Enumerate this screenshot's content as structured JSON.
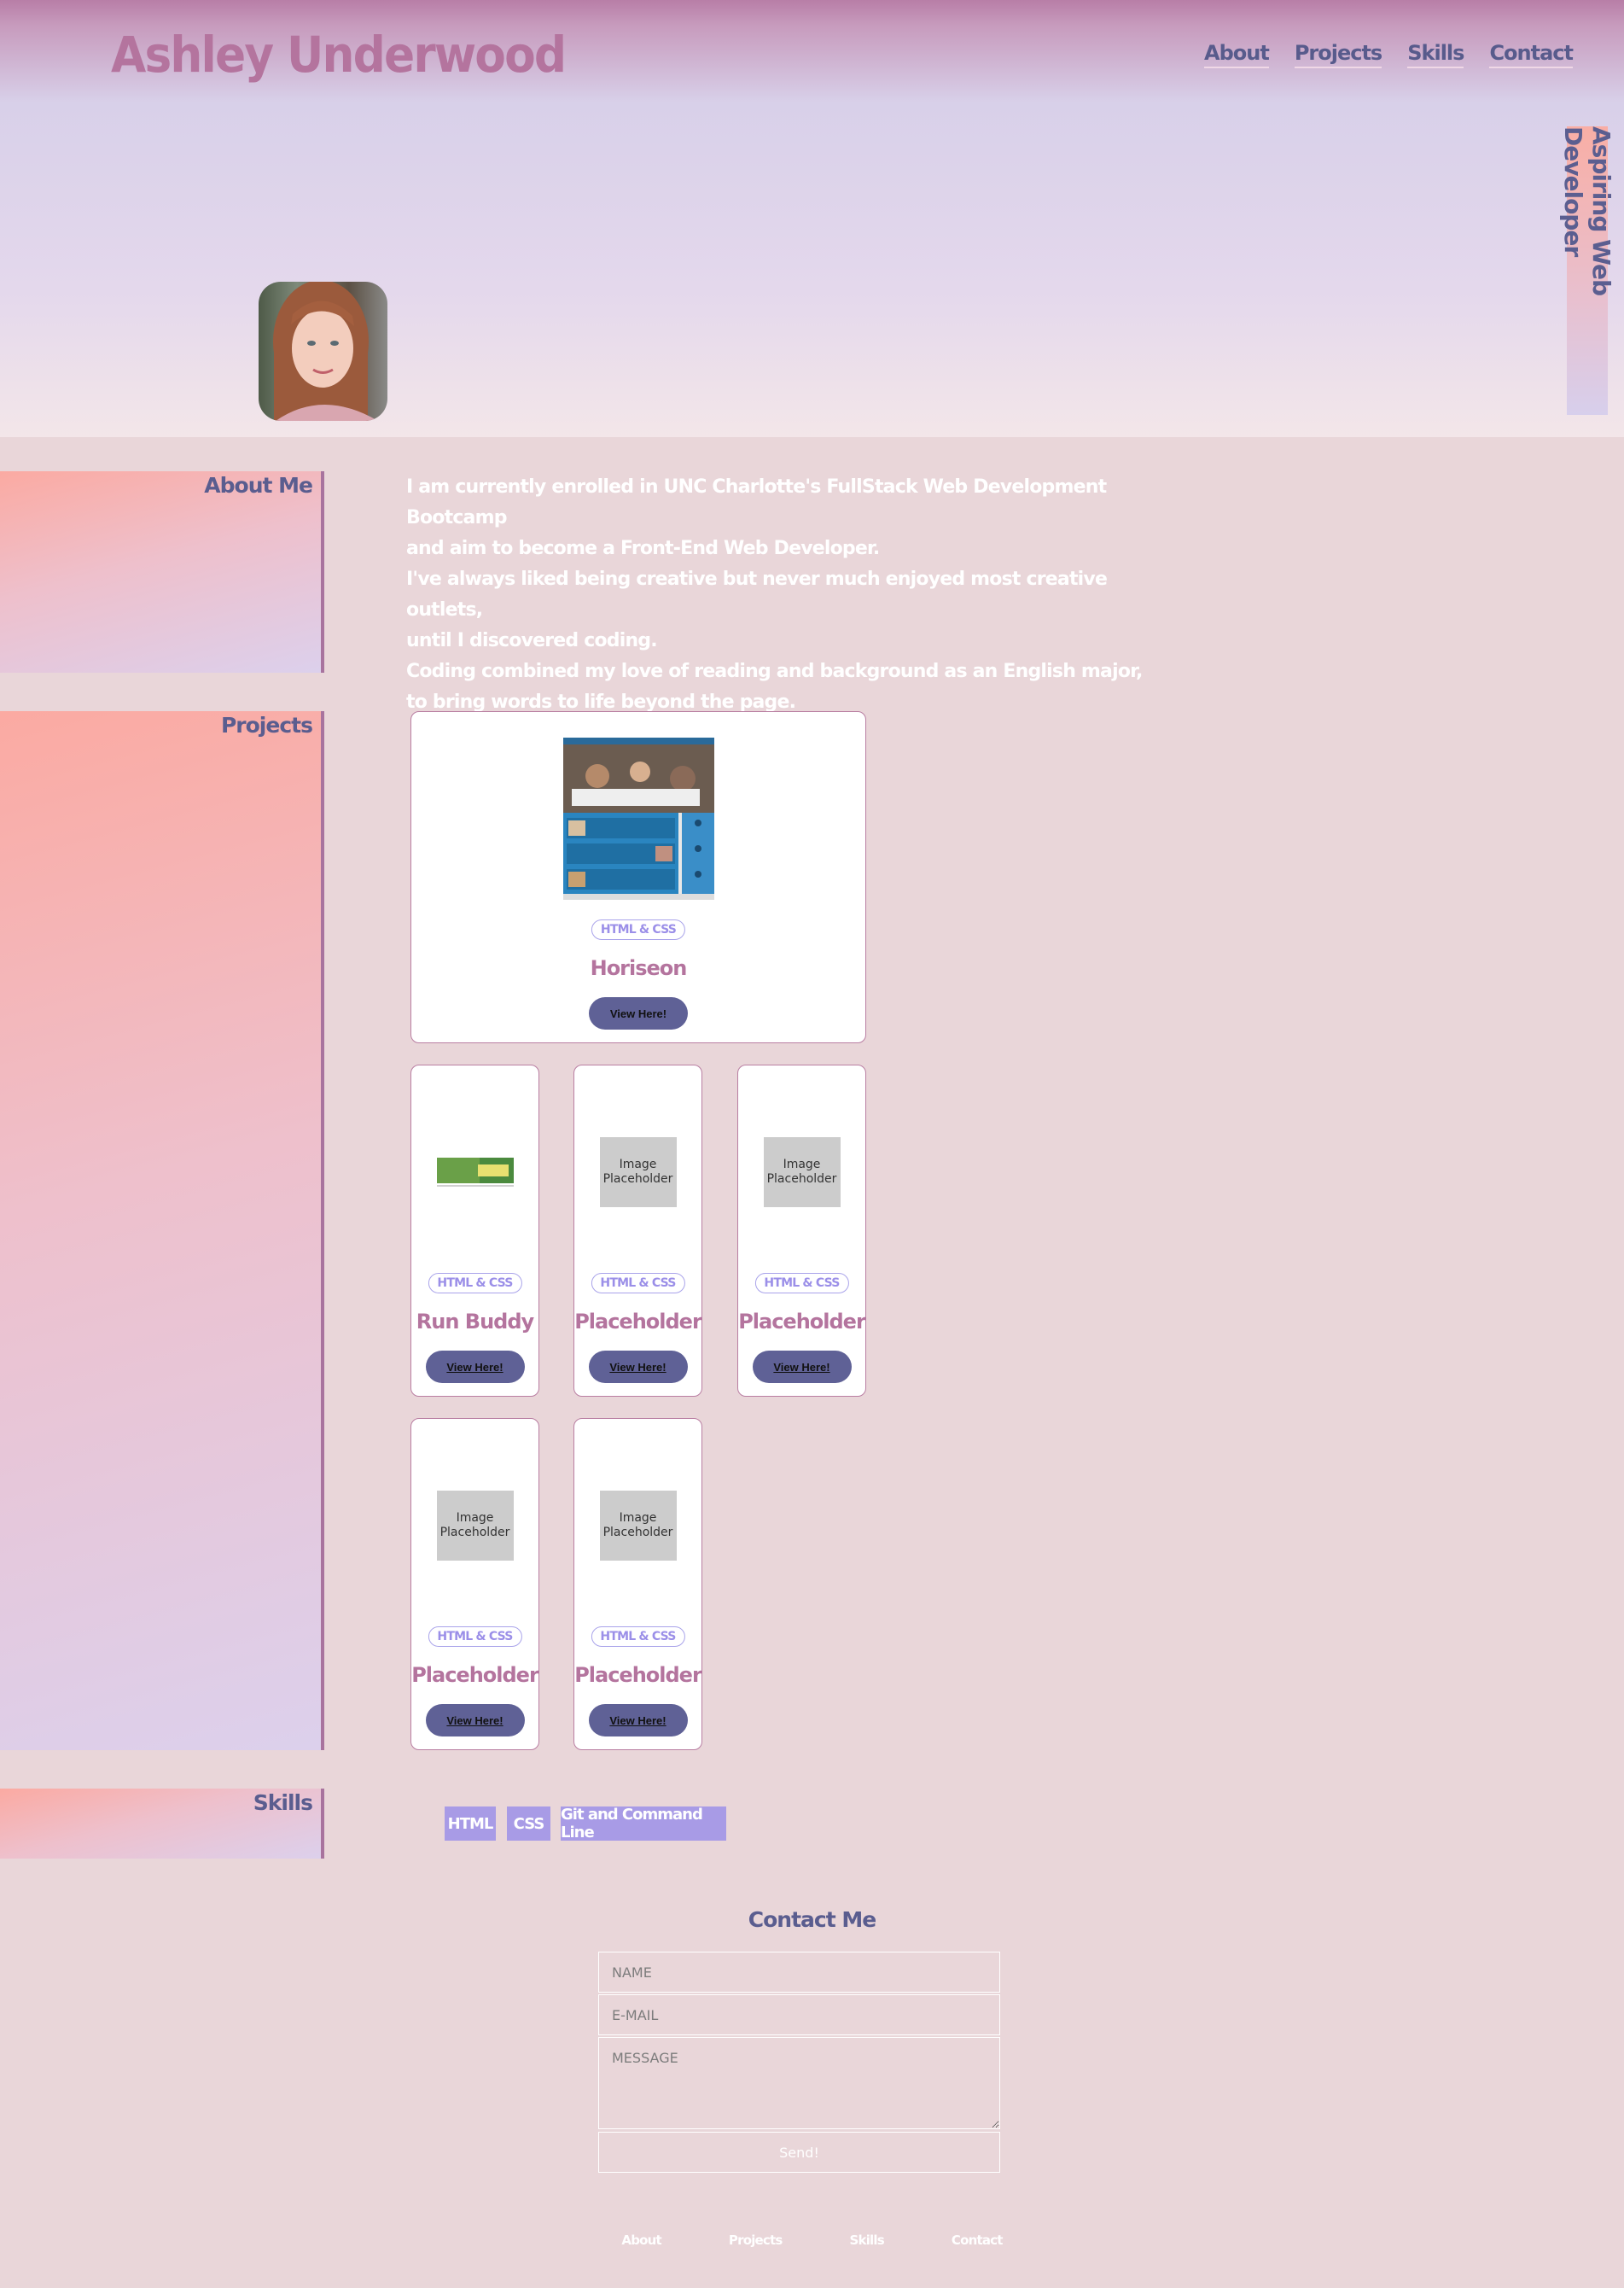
{
  "header": {
    "title": "Ashley Underwood",
    "nav": [
      "About",
      "Projects",
      "Skills",
      "Contact"
    ],
    "tagline": "Aspiring Web Developer"
  },
  "about": {
    "heading": "About Me",
    "lines": [
      "I am currently enrolled in UNC Charlotte's FullStack Web Development Bootcamp",
      "and aim to become a Front-End Web Developer.",
      "I've always liked being creative but never much enjoyed most creative outlets,",
      "until I discovered coding.",
      "Coding combined my love of reading and background as an English major,",
      "to bring words to life beyond the page."
    ]
  },
  "projects": {
    "heading": "Projects",
    "cards": [
      {
        "badge": "HTML & CSS",
        "title": "Horiseon",
        "button": "View Here!",
        "image": "horiseon-screenshot"
      },
      {
        "badge": "HTML & CSS",
        "title": "Run Buddy",
        "button": "View Here!",
        "image": "run-buddy-screenshot"
      },
      {
        "badge": "HTML & CSS",
        "title": "Placeholder",
        "button": "View Here!",
        "image_text": "Image Placeholder"
      },
      {
        "badge": "HTML & CSS",
        "title": "Placeholder",
        "button": "View Here!",
        "image_text": "Image Placeholder"
      },
      {
        "badge": "HTML & CSS",
        "title": "Placeholder",
        "button": "View Here!",
        "image_text": "Image Placeholder"
      },
      {
        "badge": "HTML & CSS",
        "title": "Placeholder",
        "button": "View Here!",
        "image_text": "Image Placeholder"
      }
    ]
  },
  "skills": {
    "heading": "Skills",
    "items": [
      "HTML",
      "CSS",
      "Git and Command Line"
    ]
  },
  "contact": {
    "heading": "Contact Me",
    "name_placeholder": "NAME",
    "email_placeholder": "E-MAIL",
    "message_placeholder": "MESSAGE",
    "send_label": "Send!"
  },
  "footer": {
    "links": [
      "About",
      "Projects",
      "Skills",
      "Contact"
    ]
  },
  "colors": {
    "accent_pink": "#b4749e",
    "nav_blue": "#585b8c",
    "button_blue": "#5f6196",
    "skill_purple": "#a89be6",
    "page_bg": "#e9d6d9"
  }
}
